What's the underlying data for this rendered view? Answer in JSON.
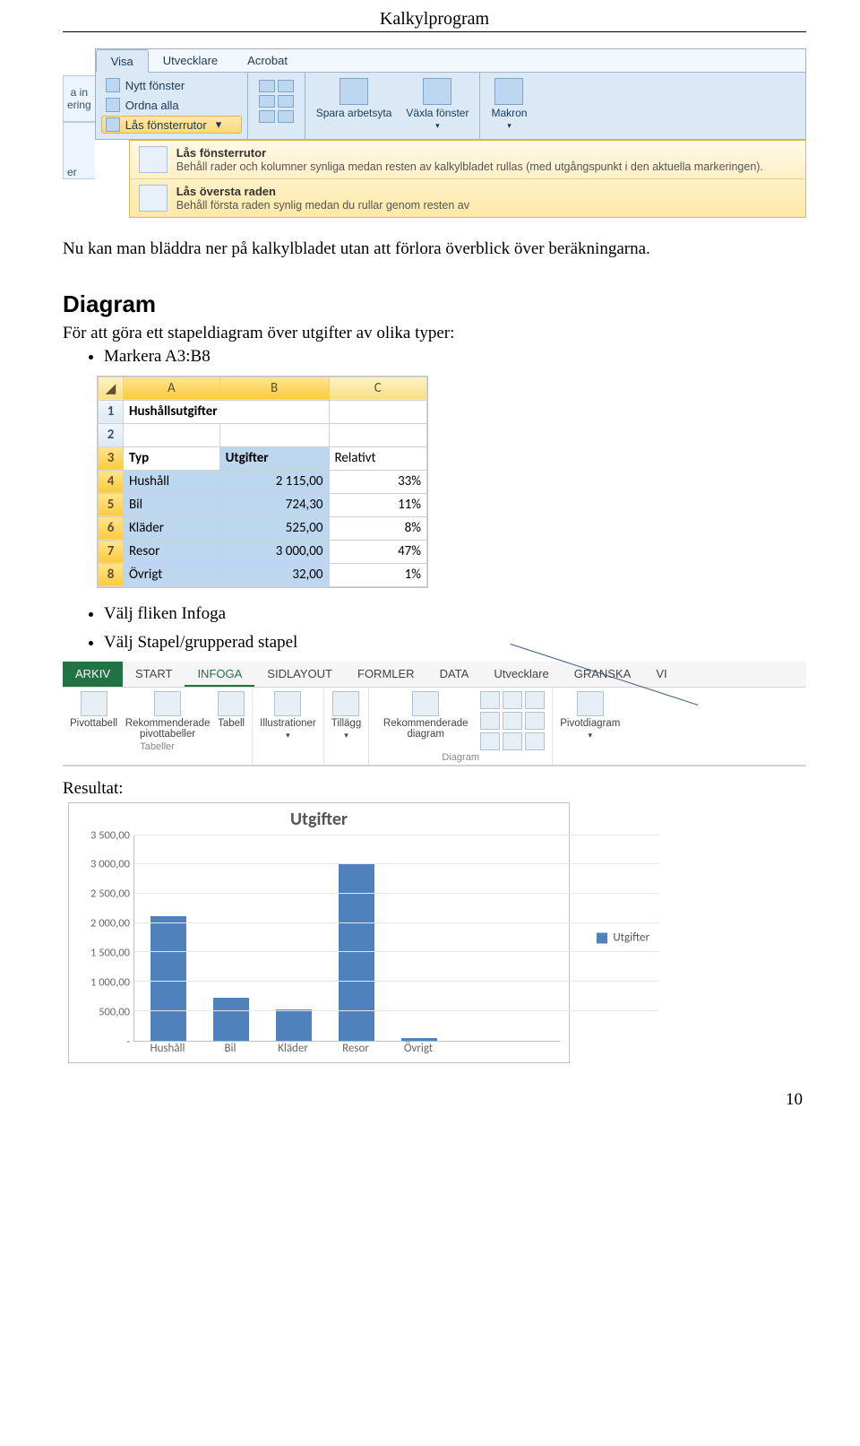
{
  "doc_title": "Kalkylprogram",
  "page_number": "10",
  "ribbon1": {
    "tabs": [
      "Visa",
      "Utvecklare",
      "Acrobat"
    ],
    "active_tab": "Visa",
    "col_left": [
      "Nytt fönster",
      "Ordna alla",
      "Lås fönsterrutor"
    ],
    "big_buttons": [
      "Spara arbetsyta",
      "Växla fönster",
      "Makron"
    ],
    "left_frag_top": "a in",
    "left_frag_mid": "ering",
    "left_frag_bot": "er",
    "dropdown": [
      {
        "title": "Lås fönsterrutor",
        "desc": "Behåll rader och kolumner synliga medan resten av kalkylbladet rullas (med utgångspunkt i den aktuella markeringen)."
      },
      {
        "title": "Lås översta raden",
        "desc": "Behåll första raden synlig medan du rullar genom resten av"
      }
    ]
  },
  "para1": "Nu kan man bläddra ner på kalkylbladet utan att förlora överblick över beräkningarna.",
  "section_title": "Diagram",
  "section_intro": "För att göra ett stapeldiagram över utgifter av olika typer:",
  "bullet1": "Markera A3:B8",
  "sheet": {
    "columns": [
      "A",
      "B",
      "C"
    ],
    "title_cell": "Hushållsutgifter",
    "header": [
      "Typ",
      "Utgifter",
      "Relativt"
    ],
    "rows": [
      {
        "typ": "Hushåll",
        "utg": "2 115,00",
        "rel": "33%"
      },
      {
        "typ": "Bil",
        "utg": "724,30",
        "rel": "11%"
      },
      {
        "typ": "Kläder",
        "utg": "525,00",
        "rel": "8%"
      },
      {
        "typ": "Resor",
        "utg": "3 000,00",
        "rel": "47%"
      },
      {
        "typ": "Övrigt",
        "utg": "32,00",
        "rel": "1%"
      }
    ]
  },
  "bullet2": "Välj fliken Infoga",
  "bullet3": "Välj Stapel/grupperad stapel",
  "ribbon2": {
    "file": "ARKIV",
    "tabs": [
      "START",
      "INFOGA",
      "SIDLAYOUT",
      "FORMLER",
      "DATA",
      "Utvecklare",
      "GRANSKA",
      "VI"
    ],
    "active": "INFOGA",
    "groups": {
      "tabeller_label": "Tabeller",
      "pivottabell": "Pivottabell",
      "rekpv": "Rekommenderade pivottabeller",
      "tabell": "Tabell",
      "illustrationer": "Illustrationer",
      "tillagg": "Tillägg",
      "rekdiag": "Rekommenderade diagram",
      "diagram_label": "Diagram",
      "pivotdiagram": "Pivotdiagram"
    }
  },
  "result_label": "Resultat:",
  "chart_data": {
    "type": "bar",
    "title": "Utgifter",
    "categories": [
      "Hushåll",
      "Bil",
      "Kläder",
      "Resor",
      "Övrigt"
    ],
    "series": [
      {
        "name": "Utgifter",
        "values": [
          2115.0,
          724.3,
          525.0,
          3000.0,
          32.0
        ]
      }
    ],
    "ylim": [
      0,
      3500
    ],
    "yticks": [
      "3 500,00",
      "3 000,00",
      "2 500,00",
      "2 000,00",
      "1 500,00",
      "1 000,00",
      "500,00",
      "-"
    ],
    "legend": "Utgifter"
  }
}
